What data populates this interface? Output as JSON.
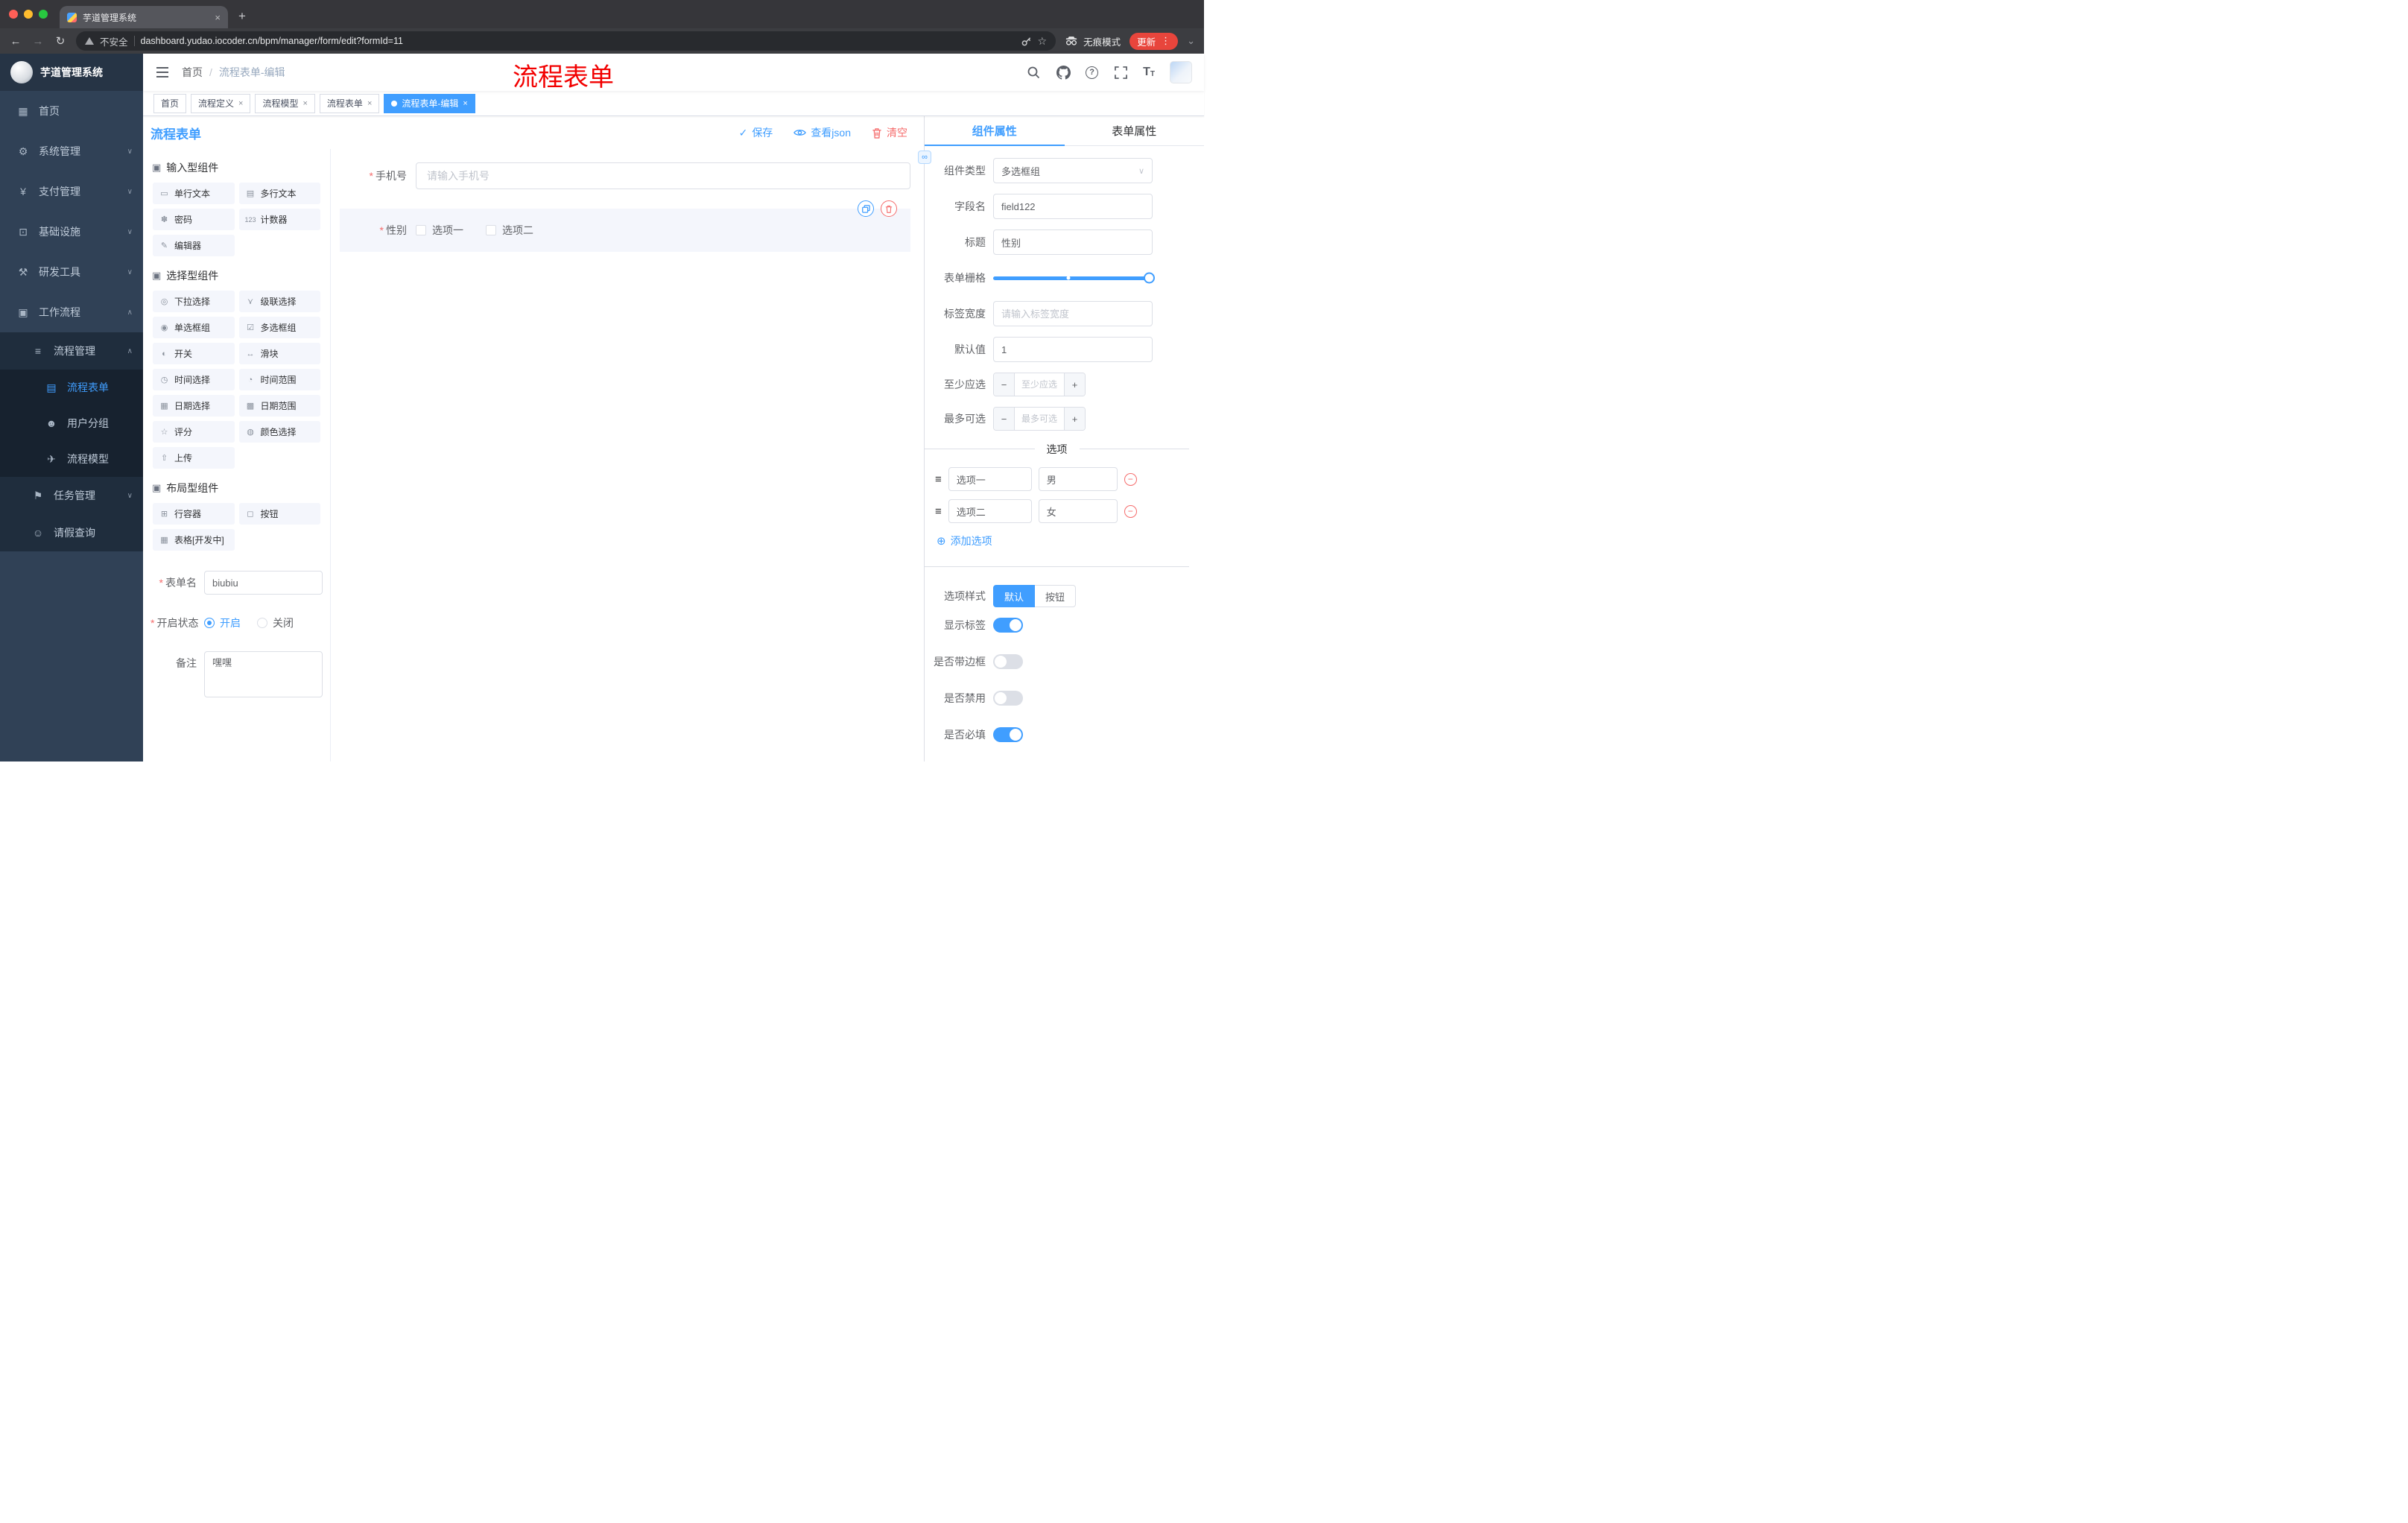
{
  "glyphs": {
    "required": "*",
    "close": "×",
    "plus": "+",
    "back": "←",
    "forward": "→",
    "reload": "↻",
    "bookmark": "☆",
    "dots": "⋮",
    "caret_down": "⌄",
    "chev_up": "∧",
    "chev_down": "∨",
    "check": "✓",
    "add": "⊕",
    "minus": "−",
    "link": "∞",
    "drag": "≡",
    "slash": "/",
    "question": "?",
    "sel_caret": "∨",
    "font_big": "T",
    "font_small": "T"
  },
  "browser": {
    "tab_title": "芋道管理系统",
    "security_label": "不安全",
    "url": "dashboard.yudao.iocoder.cn/bpm/manager/form/edit?formId=11",
    "incognito_label": "无痕模式",
    "update_label": "更新"
  },
  "annotation": "流程表单",
  "sidebar": {
    "logo_title": "芋道管理系统",
    "items": [
      {
        "icon": "▦",
        "label": "首页"
      },
      {
        "icon": "⚙",
        "label": "系统管理"
      },
      {
        "icon": "¥",
        "label": "支付管理"
      },
      {
        "icon": "⊡",
        "label": "基础设施"
      },
      {
        "icon": "⚒",
        "label": "研发工具"
      },
      {
        "icon": "▣",
        "label": "工作流程"
      },
      {
        "icon": "≡",
        "label": "流程管理"
      },
      {
        "icon": "▤",
        "label": "流程表单"
      },
      {
        "icon": "☻",
        "label": "用户分组"
      },
      {
        "icon": "✈",
        "label": "流程模型"
      },
      {
        "icon": "⚑",
        "label": "任务管理"
      },
      {
        "icon": "☺",
        "label": "请假查询"
      }
    ]
  },
  "navbar": {
    "breadcrumb": {
      "home": "首页",
      "current": "流程表单-编辑"
    }
  },
  "tags": [
    {
      "label": "首页"
    },
    {
      "label": "流程定义"
    },
    {
      "label": "流程模型"
    },
    {
      "label": "流程表单"
    },
    {
      "label": "流程表单-编辑"
    }
  ],
  "designer": {
    "title": "流程表单",
    "actions": {
      "save": "保存",
      "view_json": "查看json",
      "clear": "清空"
    }
  },
  "palette": {
    "sections": [
      {
        "icon": "▣",
        "title": "输入型组件",
        "items": [
          {
            "icon": "▭",
            "label": "单行文本"
          },
          {
            "icon": "▤",
            "label": "多行文本"
          },
          {
            "icon": "✽",
            "label": "密码"
          },
          {
            "icon": "123",
            "label": "计数器"
          },
          {
            "icon": "✎",
            "label": "编辑器"
          }
        ]
      },
      {
        "icon": "▣",
        "title": "选择型组件",
        "items": [
          {
            "icon": "◎",
            "label": "下拉选择"
          },
          {
            "icon": "⋎",
            "label": "级联选择"
          },
          {
            "icon": "◉",
            "label": "单选框组"
          },
          {
            "icon": "☑",
            "label": "多选框组"
          },
          {
            "icon": "◐",
            "label": "开关"
          },
          {
            "icon": "↔",
            "label": "滑块"
          },
          {
            "icon": "◷",
            "label": "时间选择"
          },
          {
            "icon": "◔",
            "label": "时间范围"
          },
          {
            "icon": "▦",
            "label": "日期选择"
          },
          {
            "icon": "▩",
            "label": "日期范围"
          },
          {
            "icon": "☆",
            "label": "评分"
          },
          {
            "icon": "◍",
            "label": "颜色选择"
          },
          {
            "icon": "⇧",
            "label": "上传"
          }
        ]
      },
      {
        "icon": "▣",
        "title": "布局型组件",
        "items": [
          {
            "icon": "⊞",
            "label": "行容器"
          },
          {
            "icon": "◻",
            "label": "按钮"
          },
          {
            "icon": "▦",
            "label": "表格[开发中]"
          }
        ]
      }
    ],
    "form": {
      "name_label": "表单名",
      "name_value": "biubiu",
      "status_label": "开启状态",
      "status_on": "开启",
      "status_off": "关闭",
      "remark_label": "备注",
      "remark_value": "嘿嘿"
    }
  },
  "canvas": {
    "phone_label": "手机号",
    "phone_placeholder": "请输入手机号",
    "gender_label": "性别",
    "gender_options": [
      "选项一",
      "选项二"
    ]
  },
  "props": {
    "tab_component": "组件属性",
    "tab_form": "表单属性",
    "component_type_label": "组件类型",
    "component_type_value": "多选框组",
    "field_name_label": "字段名",
    "field_name_value": "field122",
    "title_label": "标题",
    "title_value": "性别",
    "grid_label": "表单栅格",
    "label_width_label": "标签宽度",
    "label_width_placeholder": "请输入标签宽度",
    "default_label": "默认值",
    "default_value": "1",
    "min_label": "至少应选",
    "min_placeholder": "至少应选",
    "max_label": "最多可选",
    "max_placeholder": "最多可选",
    "options_divider": "选项",
    "options": [
      {
        "label": "选项一",
        "value": "男"
      },
      {
        "label": "选项二",
        "value": "女"
      }
    ],
    "add_option": "添加选项",
    "style_label": "选项样式",
    "style_default": "默认",
    "style_button": "按钮",
    "switches": [
      {
        "label": "显示标签",
        "on": true
      },
      {
        "label": "是否带边框",
        "on": false
      },
      {
        "label": "是否禁用",
        "on": false
      },
      {
        "label": "是否必填",
        "on": true
      }
    ]
  }
}
